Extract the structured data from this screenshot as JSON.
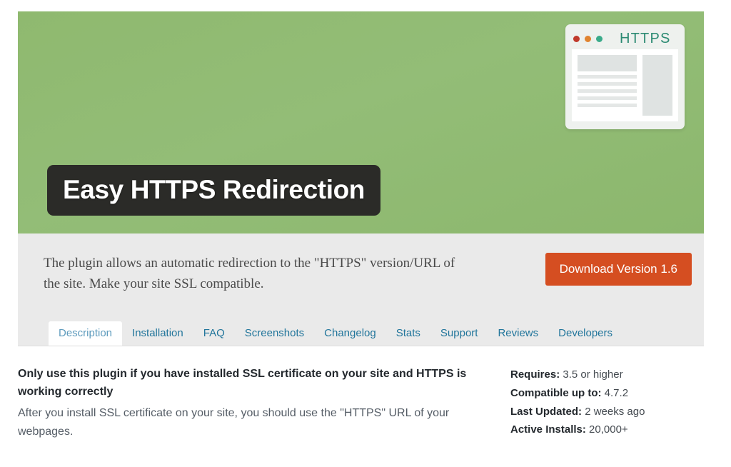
{
  "banner": {
    "title": "Easy HTTPS Redirection",
    "background_color": "#8fb96f",
    "title_box_color": "#2b2b28",
    "mockup": {
      "https_label": "HTTPS",
      "https_color": "#2b8a72",
      "dots": [
        {
          "name": "close-dot",
          "color": "#c0392b"
        },
        {
          "name": "minimize-dot",
          "color": "#e0832f"
        },
        {
          "name": "maximize-dot",
          "color": "#3aab8a"
        }
      ]
    }
  },
  "header": {
    "description": "The plugin allows an automatic redirection to the \"HTTPS\" version/URL of the site. Make your site SSL compatible.",
    "download_label": "Download Version 1.6",
    "download_color": "#d54e21"
  },
  "tabs": [
    {
      "label": "Description",
      "active": true
    },
    {
      "label": "Installation",
      "active": false
    },
    {
      "label": "FAQ",
      "active": false
    },
    {
      "label": "Screenshots",
      "active": false
    },
    {
      "label": "Changelog",
      "active": false
    },
    {
      "label": "Stats",
      "active": false
    },
    {
      "label": "Support",
      "active": false
    },
    {
      "label": "Reviews",
      "active": false
    },
    {
      "label": "Developers",
      "active": false
    }
  ],
  "content": {
    "heading": "Only use this plugin if you have installed SSL certificate on your site and HTTPS is working correctly",
    "paragraph": "After you install SSL certificate on your site, you should use the \"HTTPS\" URL of your webpages."
  },
  "sidebar_meta": [
    {
      "label": "Requires:",
      "value": "3.5 or higher"
    },
    {
      "label": "Compatible up to:",
      "value": "4.7.2"
    },
    {
      "label": "Last Updated:",
      "value": "2 weeks ago"
    },
    {
      "label": "Active Installs:",
      "value": "20,000+"
    }
  ]
}
